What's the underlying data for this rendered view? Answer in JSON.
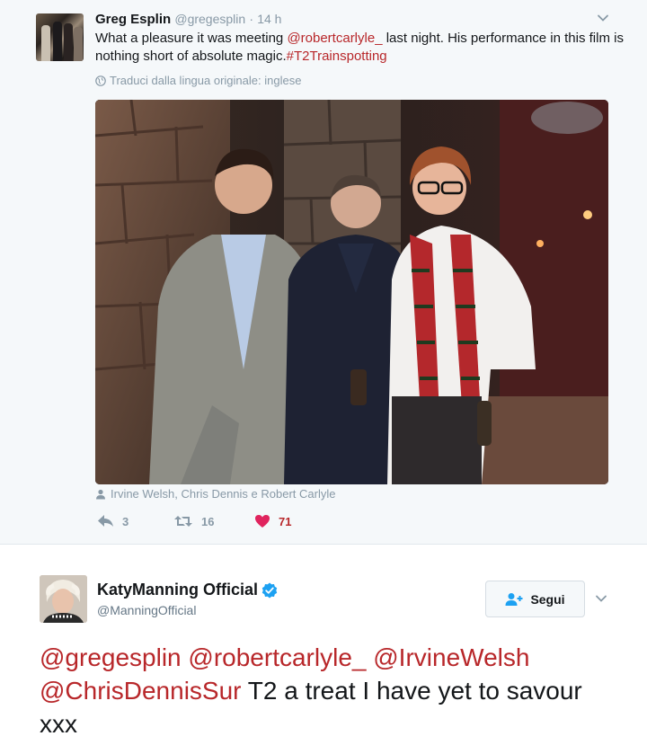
{
  "context_tweet": {
    "author_name": "Greg Esplin",
    "author_handle": "@gregesplin",
    "separator": "·",
    "time": "14 h",
    "text_parts": {
      "part1": "What a pleasure it was meeting ",
      "mention": "@robertcarlyle_",
      "part2": " last night.  His performance in this film is nothing short of absolute magic.",
      "hashtag": "#T2Trainspotting"
    },
    "translate_label": "Traduci dalla lingua originale: inglese",
    "photo_tags": "Irvine Welsh, Chris Dennis e Robert Carlyle",
    "reply_count": "3",
    "retweet_count": "16",
    "like_count": "71",
    "colors": {
      "link": "#b8272a",
      "like": "#e0245e",
      "muted": "#8899a6"
    }
  },
  "main_tweet": {
    "author_name": "KatyManning Official",
    "author_handle": "@ManningOfficial",
    "verified": true,
    "follow_label": "Segui",
    "text_parts": {
      "mention1": "@gregesplin",
      "mention2": "@robertcarlyle_",
      "mention3": "@IrvineWelsh",
      "mention4": "@ChrisDennisSur",
      "rest": " T2 a treat I have yet to savour xxx"
    }
  },
  "icons": [
    "chevron-down-icon",
    "globe-icon",
    "person-tag-icon",
    "reply-icon",
    "retweet-icon",
    "heart-icon",
    "verified-badge-icon",
    "follow-person-icon"
  ]
}
